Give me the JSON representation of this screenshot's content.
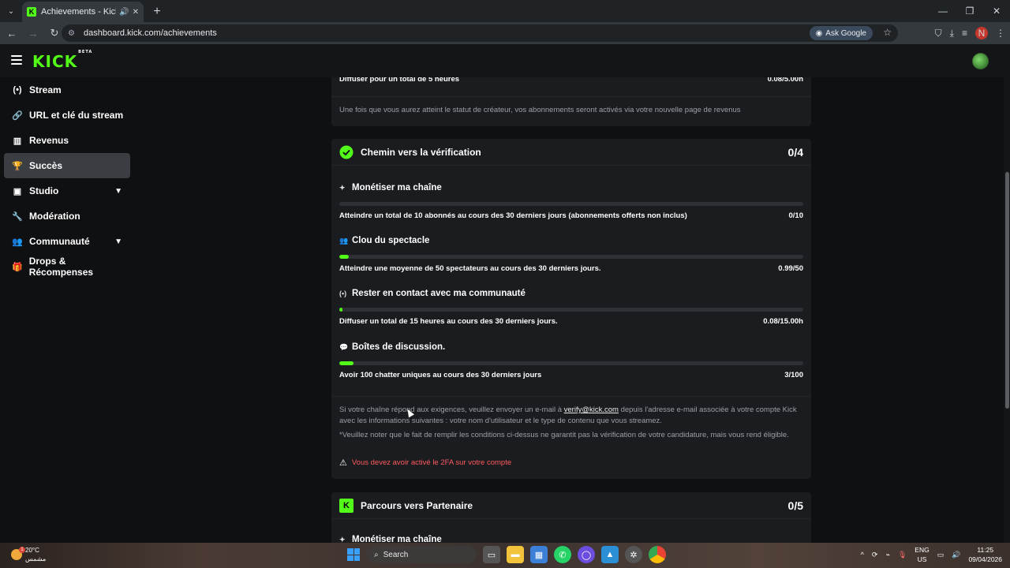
{
  "browser": {
    "tab_title": "Achievements - Kick Dashb",
    "url": "dashboard.kick.com/achievements",
    "ask_google": "Ask Google",
    "profile_initial": "N"
  },
  "kick": {
    "logo": "KICK",
    "logo_badge": "BETA"
  },
  "sidebar": {
    "items": [
      {
        "label": "Stream",
        "icon": "broadcast-icon"
      },
      {
        "label": "URL et clé du stream",
        "icon": "link-icon"
      },
      {
        "label": "Revenus",
        "icon": "chart-icon"
      },
      {
        "label": "Succès",
        "icon": "trophy-icon",
        "active": true
      },
      {
        "label": "Studio",
        "icon": "studio-icon",
        "expandable": true
      },
      {
        "label": "Modération",
        "icon": "wrench-icon"
      },
      {
        "label": "Communauté",
        "icon": "people-icon",
        "expandable": true
      },
      {
        "label": "Drops & Récompenses",
        "icon": "gift-icon"
      }
    ]
  },
  "top_card": {
    "goal_label": "Diffuser pour un total de 5 heures",
    "goal_value": "0.08/5.00h",
    "note": "Une fois que vous aurez atteint le statut de créateur, vos abonnements seront activés via votre nouvelle page de revenus"
  },
  "verification": {
    "title": "Chemin vers la vérification",
    "count": "0/4",
    "goals": [
      {
        "title": "Monétiser ma chaîne",
        "desc": "Atteindre un total de 10 abonnés au cours des 30 derniers jours (abonnements offerts non inclus)",
        "value": "0/10",
        "progress": 0
      },
      {
        "title": "Clou du spectacle",
        "desc": "Atteindre une moyenne de 50 spectateurs au cours des 30 derniers jours.",
        "value": "0.99/50",
        "progress": 0.0198
      },
      {
        "title": "Rester en contact avec ma communauté",
        "desc": "Diffuser un total de 15 heures au cours des 30 derniers jours.",
        "value": "0.08/15.00h",
        "progress": 0.0053
      },
      {
        "title": "Boîtes de discussion.",
        "desc": "Avoir 100 chatter uniques au cours des 30 derniers jours",
        "value": "3/100",
        "progress": 0.03
      }
    ],
    "info_pre": "Si votre chaîne répond aux exigences, veuillez envoyer un e-mail à ",
    "info_link": "verify@kick.com",
    "info_post": " depuis l'adresse e-mail associée à votre compte Kick avec les informations suivantes : votre nom d'utilisateur et le type de contenu que vous streamez.",
    "disclaimer": "*Veuillez noter que le fait de remplir les conditions ci-dessus ne garantit pas la vérification de votre candidature, mais vous rend éligible.",
    "warning": "Vous devez avoir activé le 2FA sur votre compte"
  },
  "partner": {
    "title": "Parcours vers Partenaire",
    "count": "0/5",
    "first_goal": "Monétiser ma chaîne"
  },
  "taskbar": {
    "temp": "20°C",
    "weather": "مشمس",
    "search": "Search",
    "lang1": "ENG",
    "lang2": "US",
    "time": "11:25",
    "date": "09/04/2026"
  },
  "colors": {
    "accent": "#53fc18",
    "warning": "#ff5a5f"
  }
}
